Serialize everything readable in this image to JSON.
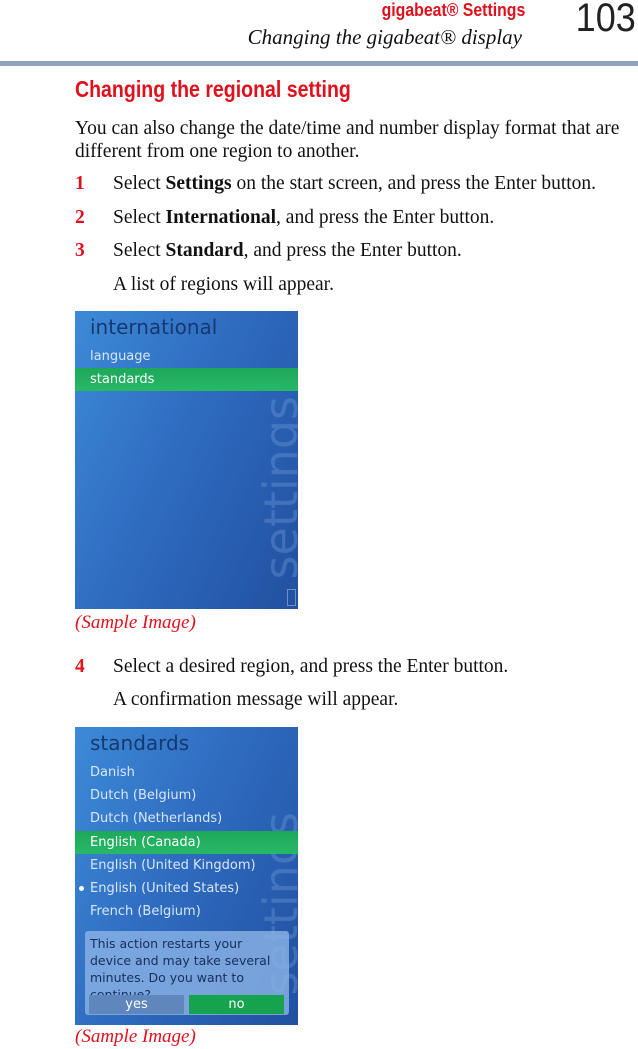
{
  "header": {
    "section": "gigabeat® Settings",
    "subsection": "Changing the gigabeat® display",
    "page_number": "103"
  },
  "heading": "Changing the regional setting",
  "intro": "You can also change the date/time and number display format that are different from one region to another.",
  "steps": [
    {
      "num": "1",
      "pre": "Select ",
      "bold": "Settings",
      "post": " on the start screen, and press the Enter button."
    },
    {
      "num": "2",
      "pre": "Select ",
      "bold": "International",
      "post": ", and press the Enter button."
    },
    {
      "num": "3",
      "pre": "Select ",
      "bold": "Standard",
      "post": ", and press the Enter button."
    },
    {
      "num": "4",
      "pre": "Select a desired region, and press the Enter button.",
      "bold": "",
      "post": ""
    }
  ],
  "step3_result": "A list of regions will appear.",
  "step4_result": "A confirmation message will appear.",
  "caption": "(Sample Image)",
  "screen1": {
    "title": "international",
    "items": [
      "language",
      "standards"
    ],
    "selected": "standards",
    "watermark": "settings"
  },
  "screen2": {
    "title": "standards",
    "items": [
      "Danish",
      "Dutch (Belgium)",
      "Dutch (Netherlands)",
      "English (Canada)",
      "English (United Kingdom)",
      "English (United States)",
      "French (Belgium)"
    ],
    "selected": "English (Canada)",
    "current": "English (United States)",
    "watermark": "settings",
    "dialog": {
      "message": "This action restarts your device and may take several minutes. Do you want to continue?",
      "yes": "yes",
      "no": "no"
    }
  },
  "colors": {
    "accent_red": "#e0101c",
    "rule": "#8fa3bf",
    "highlight_green": "#1ea85a"
  }
}
